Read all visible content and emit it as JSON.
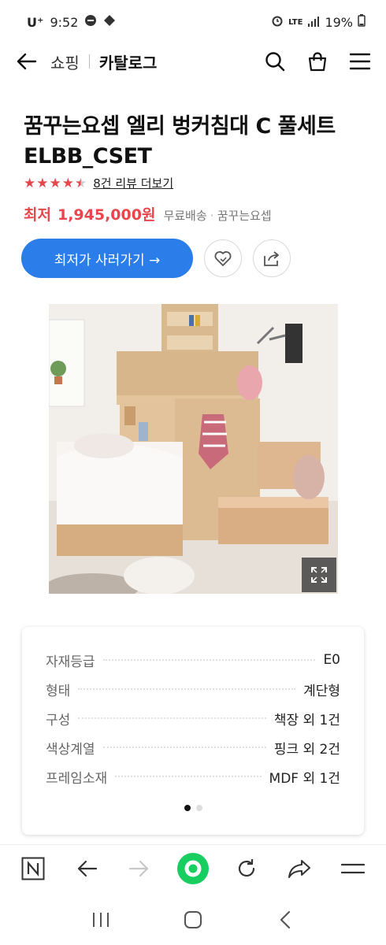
{
  "status_bar": {
    "carrier": "U⁺",
    "time": "9:52",
    "network": "LTE",
    "battery": "19%"
  },
  "nav": {
    "shop": "쇼핑",
    "catalog": "카탈로그"
  },
  "product": {
    "title_line1": "꿈꾸는요셉 엘리 벙커침대 C 풀세트",
    "title_line2": "ELBB_CSET",
    "rating": 4.5,
    "review_link": "8건 리뷰 더보기",
    "price_label": "최저",
    "price": "1,945,000원",
    "shipping": "무료배송",
    "seller": "꿈꾸는요셉",
    "cta": "최저가 사러가기 →"
  },
  "specs": [
    {
      "label": "자재등급",
      "value": "E0"
    },
    {
      "label": "형태",
      "value": "계단형"
    },
    {
      "label": "구성",
      "value": "책장 외 1건"
    },
    {
      "label": "색상계열",
      "value": "핑크 외 2건"
    },
    {
      "label": "프레임소재",
      "value": "MDF 외 1건"
    }
  ],
  "colors": {
    "accent": "#2b7de9",
    "price_red": "#e8454d",
    "naver_green": "#19ce60"
  }
}
